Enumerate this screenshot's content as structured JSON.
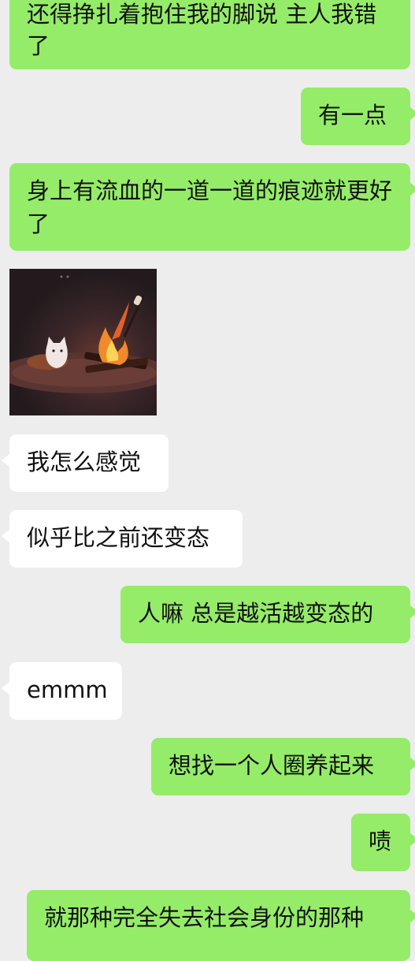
{
  "messages": [
    {
      "sender": "me",
      "text": "还得挣扎着抱住我的脚说 主人我错了"
    },
    {
      "sender": "me",
      "text": "有一点"
    },
    {
      "sender": "me",
      "text": "身上有流血的一道一道的痕迹就更好了"
    },
    {
      "sender": "other",
      "type": "sticker",
      "sticker": "campfire-cat-sticker"
    },
    {
      "sender": "other",
      "text": "我怎么感觉"
    },
    {
      "sender": "other",
      "text": "似乎比之前还变态"
    },
    {
      "sender": "me",
      "text": "人嘛 总是越活越变态的"
    },
    {
      "sender": "other",
      "text": "emmm"
    },
    {
      "sender": "me",
      "text": "想找一个人圈养起来"
    },
    {
      "sender": "me",
      "text": "啧"
    },
    {
      "sender": "me",
      "text": "就那种完全失去社会身份的那种"
    }
  ],
  "colors": {
    "background": "#ededed",
    "my_bubble": "#95ec69",
    "other_bubble": "#ffffff",
    "text": "#111111"
  }
}
